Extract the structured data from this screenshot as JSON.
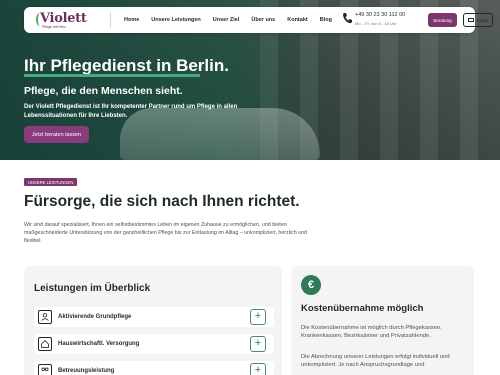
{
  "nav": {
    "logo_text": "Violett",
    "logo_sub": "Pflege mit Herz",
    "items": [
      "Home",
      "Unsere Leistungen",
      "Unser Ziel",
      "Über uns",
      "Kontakt",
      "Blog"
    ],
    "phone": "+49 30 23 30 112 00",
    "hours": "Mo. - Fr. von 8 - 16 Uhr",
    "beratung_label": "Beratung",
    "email_label": "Email"
  },
  "hero": {
    "title": "Ihr Pflegedienst in Berlin.",
    "subtitle": "Pflege, die den Menschen sieht.",
    "text": "Der Violett Pflegedienst ist Ihr kompetenter Partner rund um Pflege in allen Lebenssituationen für Ihre Liebsten.",
    "cta": "Jetzt beraten lassen"
  },
  "section": {
    "tag": "UNSERE LEISTUNGEN",
    "title": "Fürsorge, die sich nach Ihnen richtet.",
    "text": "Wir sind darauf spezialisiert, Ihnen ein selbstbestimmtes Leben im eigenen Zuhause zu ermöglichen, und bieten maßgeschneiderte Unterstützung von der ganzheitlichen Pflege bis zur Entlastung im Alltag – unkompliziert, herzlich und flexibel."
  },
  "overview": {
    "title": "Leistungen im Überblick",
    "services": [
      {
        "label": "Aktivierende Grundpflege",
        "icon": "care-icon"
      },
      {
        "label": "Hauswirtschaftl. Versorgung",
        "icon": "home-icon"
      },
      {
        "label": "Betreuungsleistung",
        "icon": "people-icon"
      }
    ]
  },
  "costs": {
    "icon_symbol": "€",
    "title": "Kostenübernahme möglich",
    "text1": "Die Kostenübernahme ist möglich durch Pflegekassen, Krankenkassen, Bezirksämter und Privatzahlende.",
    "text2": "Die Abrechnung unserer Leistungen erfolgt individuell und unkompliziert. Je nach Anspruchsgrundlage und"
  },
  "colors": {
    "brand_purple": "#7d3570",
    "brand_green": "#2f7a58",
    "accent_underline": "#4aa97a"
  }
}
